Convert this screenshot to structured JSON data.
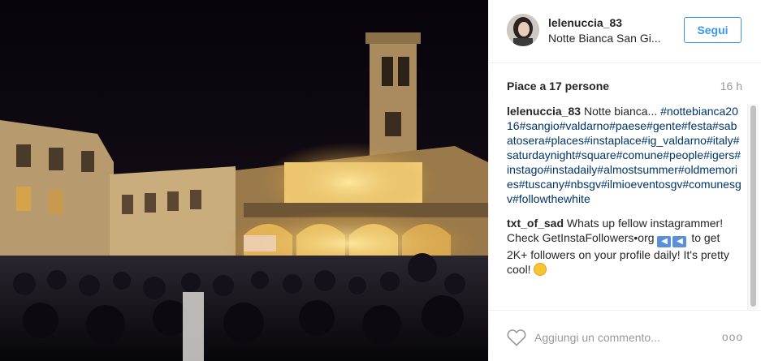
{
  "post": {
    "photo_alt": "Notte Bianca San Giovanni",
    "colors": {
      "accent": "#3897f0",
      "hashtag": "#003569",
      "muted": "#999999",
      "text": "#262626"
    }
  },
  "header": {
    "username": "lelenuccia_83",
    "location": "Notte Bianca San Gi...",
    "follow_label": "Segui"
  },
  "stats": {
    "likes": "Piace a 17 persone",
    "time_ago": "16 h"
  },
  "comments": [
    {
      "user": "lelenuccia_83",
      "text": "Notte bianca...",
      "hashtags": "#nottebianca2016#sangio#valdarno#paese#gente#festa#sabatosera#places#instaplace#ig_valdarno#italy#saturdaynight#square#comune#people#igers#instago#instadaily#almostsummer#oldmemories#tuscany#nbsgv#ilmioeventosgv#comunesgv#followthewhite"
    },
    {
      "user": "txt_of_sad",
      "text_before": "Whats up fellow instagrammer! Check GetInstaFollowers•org",
      "text_after": "to get 2K+ followers on your profile daily! It's pretty cool!",
      "emoji_arrows": [
        "arrow-left-emoji",
        "arrow-left-emoji"
      ],
      "emoji_end": "smiling-face-emoji"
    }
  ],
  "footer": {
    "comment_placeholder": "Aggiungi un commento...",
    "more_label": "ooo"
  },
  "icons": {
    "heart": "heart-outline-icon",
    "more": "more-options-icon"
  }
}
